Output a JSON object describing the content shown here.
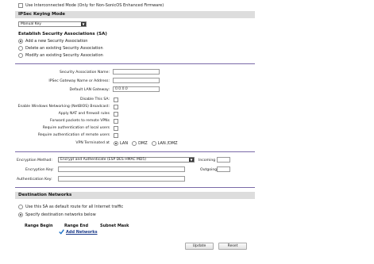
{
  "interconnected": {
    "label": "Use Interconnected Mode (Only for Non-SonicOS Enhanced Firmware)",
    "checked": false
  },
  "keying": {
    "header": "IPSec Keying Mode",
    "mode_value": "Manual Key"
  },
  "establish": {
    "header": "Establish Security Associations (SA)",
    "options": [
      {
        "label": "Add a new Security Association",
        "selected": true
      },
      {
        "label": "Delete an existing Security Association",
        "selected": false
      },
      {
        "label": "Modify an existing Security Association",
        "selected": false
      }
    ]
  },
  "sa_fields": {
    "name_label": "Security Association Name:",
    "name_value": "",
    "gateway_label": "IPSec Gateway Name or Address:",
    "gateway_value": "",
    "lan_gateway_label": "Default LAN Gateway:",
    "lan_gateway_value": "0.0.0.0"
  },
  "sa_checks": [
    {
      "label": "Disable This SA:",
      "checked": false
    },
    {
      "label": "Enable Windows Networking (NetBIOS) Broadcast:",
      "checked": false
    },
    {
      "label": "Apply NAT and firewall rules",
      "checked": false
    },
    {
      "label": "Forward packets to remote VPNs",
      "checked": false
    },
    {
      "label": "Require authentication of local users",
      "checked": false
    },
    {
      "label": "Require authentication of remote users",
      "checked": false
    }
  ],
  "vpn_terminated": {
    "label": "VPN Terminated at",
    "options": [
      {
        "label": "LAN",
        "selected": true
      },
      {
        "label": "DMZ",
        "selected": false
      },
      {
        "label": "LAN /DMZ",
        "selected": false
      }
    ]
  },
  "encryption": {
    "method_label": "Encryption Method:",
    "method_value": "Encrypt and Authenticate (ESP DES HMAC MD5)",
    "key_label": "Encryption Key:",
    "key_value": "",
    "auth_label": "Authentication Key:",
    "auth_value": "",
    "incoming_label": "Incoming SPI:",
    "incoming_value": "",
    "outgoing_label": "Outgoing SPI:",
    "outgoing_value": ""
  },
  "destination": {
    "header": "Destination Networks",
    "options": [
      {
        "label": "Use this SA as default route for all Internet traffic",
        "selected": false
      },
      {
        "label": "Specify destination networks below",
        "selected": true
      }
    ],
    "columns": [
      "Range Begin",
      "Range End",
      "Subnet Mask"
    ],
    "add_label": "Add Networks"
  },
  "buttons": {
    "update": "Update",
    "reset": "Reset"
  },
  "colors": {
    "separator": "#7a6aa8",
    "header_bg": "#dddddd",
    "link": "#1a3a8a",
    "check_icon": "#1e73c8"
  }
}
